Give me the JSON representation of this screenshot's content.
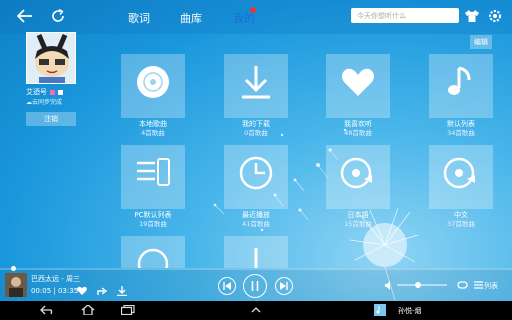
{
  "header": {
    "tabs": [
      {
        "label": "歌词",
        "active": false
      },
      {
        "label": "曲库",
        "active": false
      },
      {
        "label": "我的",
        "active": true
      }
    ],
    "search_placeholder": "今天你想听什么",
    "edit_label": "编辑"
  },
  "profile": {
    "name": "艾迺号",
    "sync_status": "云同步完成",
    "logout_label": "注销"
  },
  "tiles": [
    {
      "label": "本地歌曲",
      "count": "4首歌曲",
      "icon": "disc-icon"
    },
    {
      "label": "我的下载",
      "count": "0首歌曲",
      "icon": "download-icon"
    },
    {
      "label": "我喜欢听",
      "count": "48首歌曲",
      "icon": "heart-icon"
    },
    {
      "label": "默认列表",
      "count": "34首歌曲",
      "icon": "music-note-icon"
    },
    {
      "label": "PC默认列表",
      "count": "19首歌曲",
      "icon": "pc-list-icon"
    },
    {
      "label": "最近播放",
      "count": "41首歌曲",
      "icon": "clock-icon"
    },
    {
      "label": "日本語",
      "count": "15首歌曲",
      "icon": "playlist-disc-icon"
    },
    {
      "label": "中文",
      "count": "37首歌曲",
      "icon": "playlist-disc-icon"
    }
  ],
  "player": {
    "song": "巴西太远 - 周三",
    "time": "00:05 | 03:35",
    "list_label": "列表",
    "progress": 0.02,
    "volume": 0.4
  },
  "system": {
    "notification_title": "孙悦-烟"
  },
  "colors": {
    "active_tab": "#1a6fd6",
    "background": "#1fa0de",
    "badge": "#e33333"
  }
}
